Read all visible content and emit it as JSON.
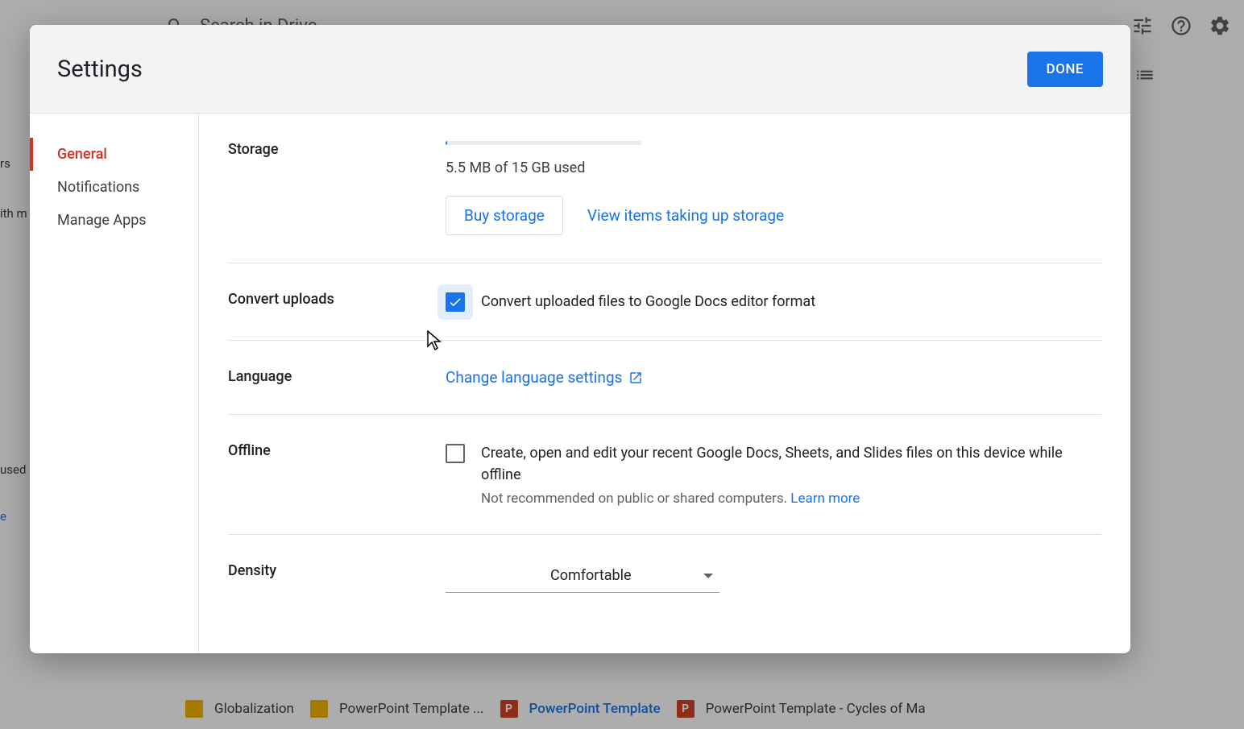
{
  "bg": {
    "search_placeholder": "Search in Drive",
    "sidebar": {
      "item1": "rs",
      "item2": "ith m",
      "item3": "used",
      "item4": "e"
    },
    "files": [
      {
        "name": "Globalization",
        "class": "ic-yellow",
        "letter": ""
      },
      {
        "name": "PowerPoint Template ...",
        "class": "ic-yellow",
        "letter": ""
      },
      {
        "name": "PowerPoint Template",
        "class": "ic-orange",
        "letter": "P",
        "selected": true
      },
      {
        "name": "PowerPoint Template - Cycles of Ma",
        "class": "ic-orange",
        "letter": "P"
      }
    ]
  },
  "modal": {
    "title": "Settings",
    "done": "DONE",
    "sidebar": {
      "general": "General",
      "notifications": "Notifications",
      "manage_apps": "Manage Apps"
    },
    "storage": {
      "label": "Storage",
      "text": "5.5 MB of 15 GB used",
      "buy": "Buy storage",
      "view": "View items taking up storage"
    },
    "convert": {
      "label": "Convert uploads",
      "text": "Convert uploaded files to Google Docs editor format",
      "checked": true
    },
    "language": {
      "label": "Language",
      "link": "Change language settings"
    },
    "offline": {
      "label": "Offline",
      "text": "Create, open and edit your recent Google Docs, Sheets, and Slides files on this device while offline",
      "subtext": "Not recommended on public or shared computers.",
      "learn": "Learn more",
      "checked": false
    },
    "density": {
      "label": "Density",
      "value": "Comfortable"
    }
  }
}
